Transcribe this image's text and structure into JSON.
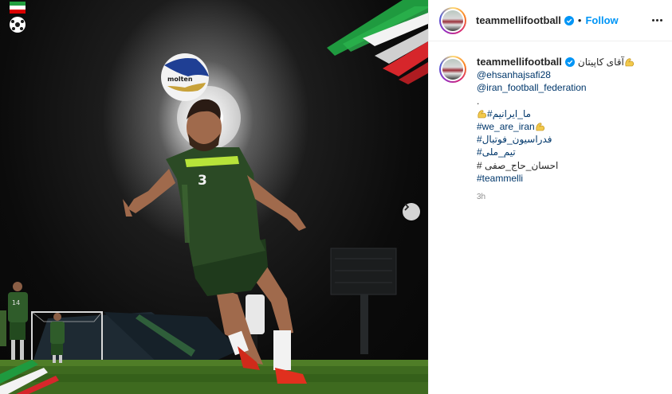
{
  "post": {
    "username": "teammellifootball",
    "separator": "•",
    "follow_label": "Follow",
    "verified_icon": "verified-badge-icon",
    "accent": "#0095f6",
    "link_color": "#00376b"
  },
  "caption": {
    "title_text": "آقای کاپیتان",
    "lines": [
      "@ehsanhajsafi28",
      "@iran_football_federation",
      ".",
      "#ما_ایرانیم",
      "#we_are_iran",
      "#فدراسیون_فوتبال",
      "#تیم_ملی",
      "# احسان_حاج_صفی",
      "#teammelli"
    ],
    "timestamp": "3h"
  },
  "media": {
    "jersey_number": "3",
    "ball_brand": "molten",
    "next_icon": "chevron-right-icon"
  }
}
